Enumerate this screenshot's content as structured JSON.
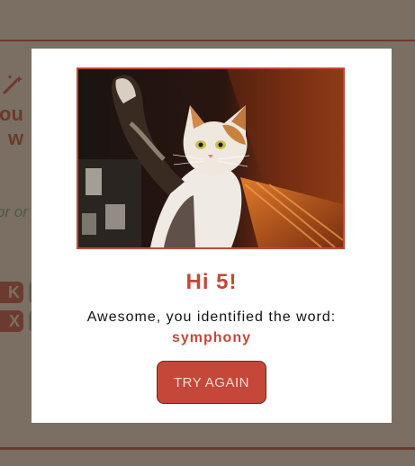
{
  "background": {
    "fragment_line1": "ou",
    "fragment_line2": "w",
    "fragment_hint": "or or",
    "key_1": "K",
    "key_2": "X"
  },
  "modal": {
    "image_alt": "Cat raising paw for a high five",
    "title": "Hi 5!",
    "message": "Awesome, you identified the word:",
    "word": "symphony",
    "try_again_label": "TRY AGAIN"
  },
  "colors": {
    "accent": "#c5473a",
    "overlay": "#7b6f63",
    "modal_bg": "#ffffff"
  }
}
